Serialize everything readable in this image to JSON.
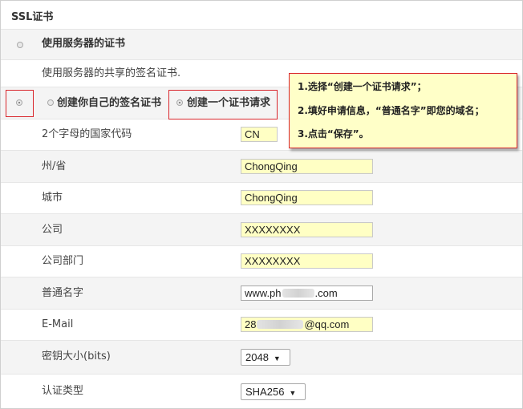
{
  "section": {
    "title": "SSL证书"
  },
  "use_server_cert": {
    "label": "使用服务器的证书",
    "description": "使用服务器的共享的签名证书."
  },
  "options": {
    "self_signed_label": "创建你自己的签名证书",
    "create_request_label": "创建一个证书请求"
  },
  "form": {
    "fields": [
      {
        "label": "2个字母的国家代码",
        "value": "CN"
      },
      {
        "label": "州/省",
        "value": "ChongQing"
      },
      {
        "label": "城市",
        "value": "ChongQing"
      },
      {
        "label": "公司",
        "value": "XXXXXXXX"
      },
      {
        "label": "公司部门",
        "value": "XXXXXXXX"
      }
    ],
    "common_name": {
      "label": "普通名字",
      "value_prefix": "www.ph",
      "value_suffix": ".com"
    },
    "email": {
      "label": "E-Mail",
      "value_prefix": "28",
      "value_suffix": "@qq.com"
    },
    "key_size": {
      "label": "密钥大小(bits)",
      "value": "2048"
    },
    "auth_type": {
      "label": "认证类型",
      "value": "SHA256"
    }
  },
  "callout": {
    "lines": [
      "1.选择“创建一个证书请求”；",
      "2.填好申请信息，“普通名字”即您的域名；",
      "3.点击“保存”。"
    ]
  },
  "colors": {
    "highlight_border": "#d9262c",
    "field_fill": "#ffffc4",
    "callout_fill": "#ffffc8",
    "row_gray": "#f4f4f4"
  }
}
